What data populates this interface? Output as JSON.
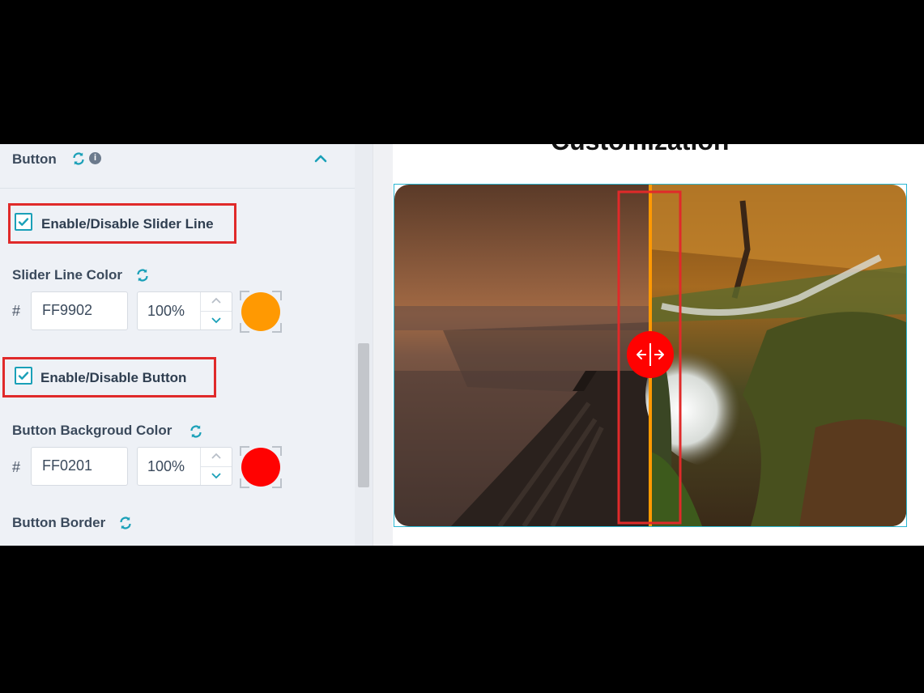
{
  "section": {
    "title": "Button"
  },
  "slider_line_toggle": {
    "label": "Enable/Disable Slider Line",
    "checked": true
  },
  "slider_line_color": {
    "label": "Slider Line Color",
    "hash": "#",
    "hex": "FF9902",
    "opacity": "100%",
    "swatch": "#FF9902"
  },
  "button_toggle": {
    "label": "Enable/Disable Button",
    "checked": true
  },
  "button_bg_color": {
    "label": "Button Backgroud Color",
    "hash": "#",
    "hex": "FF0201",
    "opacity": "100%",
    "swatch": "#FF0201"
  },
  "button_border": {
    "label": "Button Border"
  },
  "preview": {
    "heading": "Customization",
    "slider_line_color": "#FF9902",
    "handle_color": "#FF0201",
    "highlight_color": "#E02A2A",
    "divider_position": 0.5
  },
  "colors": {
    "accent": "#1AA0B8",
    "panel_bg": "#EEF1F6",
    "label": "#3B4A5C"
  }
}
